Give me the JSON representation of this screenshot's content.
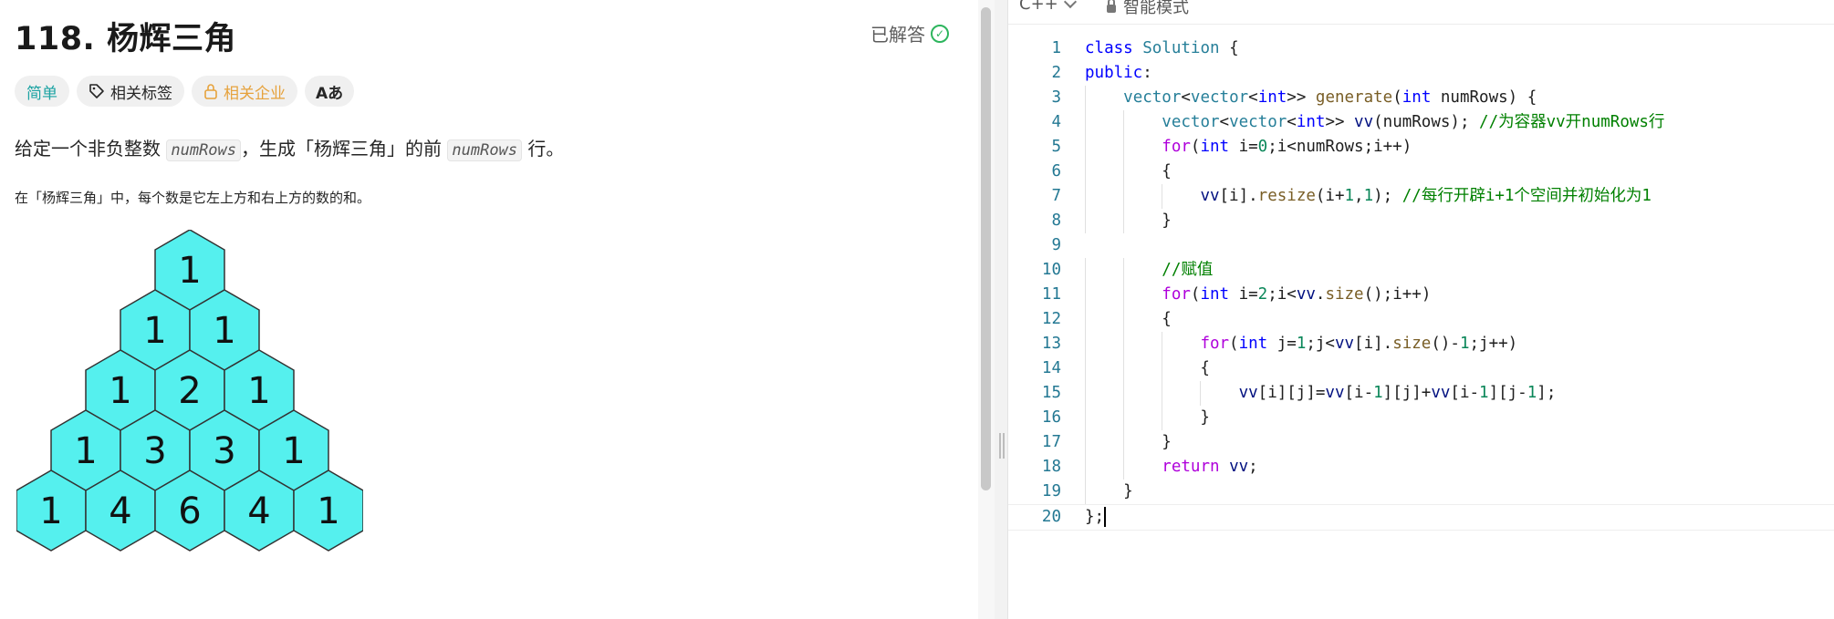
{
  "problem": {
    "title": "118. 杨辉三角",
    "status": "已解答",
    "tags": {
      "difficulty": "简单",
      "related_tags": "相关标签",
      "related_companies": "相关企业",
      "translate": "Aあ"
    },
    "desc_prefix": "给定一个非负整数",
    "desc_var1": "numRows",
    "desc_middle": "，生成「杨辉三角」的前",
    "desc_var2": "numRows",
    "desc_suffix": "行。",
    "note": "在「杨辉三角」中，每个数是它左上方和右上方的数的和。",
    "triangle": [
      [
        1
      ],
      [
        1,
        1
      ],
      [
        1,
        2,
        1
      ],
      [
        1,
        3,
        3,
        1
      ],
      [
        1,
        4,
        6,
        4,
        1
      ]
    ]
  },
  "editor": {
    "language": "C++",
    "mode": "智能模式",
    "line_numbers": [
      "1",
      "2",
      "3",
      "4",
      "5",
      "6",
      "7",
      "8",
      "9",
      "10",
      "11",
      "12",
      "13",
      "14",
      "15",
      "16",
      "17",
      "18",
      "19",
      "20"
    ],
    "code_lines": [
      "class Solution {",
      "public:",
      "    vector<vector<int>> generate(int numRows) {",
      "        vector<vector<int>> vv(numRows); //为容器vv开numRows行",
      "        for(int i=0;i<numRows;i++)",
      "        {",
      "            vv[i].resize(i+1,1); //每行开辟i+1个空间并初始化为1",
      "        }",
      "",
      "        //赋值",
      "        for(int i=2;i<vv.size();i++)",
      "        {",
      "            for(int j=1;j<vv[i].size()-1;j++)",
      "            {",
      "                vv[i][j]=vv[i-1][j]+vv[i-1][j-1];",
      "            }",
      "        }",
      "        return vv;",
      "    }",
      "};"
    ]
  },
  "colors": {
    "hex_fill": "#55f0ee",
    "easy": "#1ca3a3",
    "company": "#e6a23c",
    "solved": "#2db55d"
  }
}
